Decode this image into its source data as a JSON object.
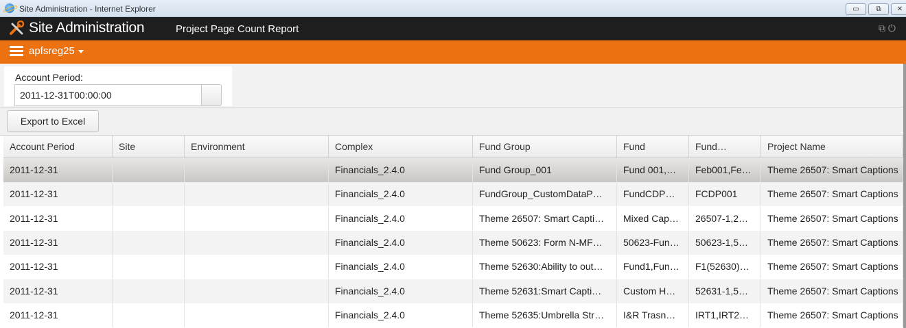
{
  "window": {
    "title": "Site Administration - Internet Explorer"
  },
  "app": {
    "title": "Site Administration",
    "report_title": "Project Page Count Report"
  },
  "tenant": {
    "name": "apfsreg25"
  },
  "filter": {
    "label": "Account Period:",
    "value": "2011-12-31T00:00:00"
  },
  "toolbar": {
    "export_label": "Export to Excel"
  },
  "grid": {
    "columns": [
      "Account Period",
      "Site",
      "Environment",
      "Complex",
      "Fund Group",
      "Fund",
      "Fund…",
      "Project Name"
    ],
    "rows": [
      [
        "2011-12-31",
        "",
        "",
        "Financials_2.4.0",
        "Fund Group_001",
        "Fund 001,…",
        "Feb001,Fe…",
        "Theme 26507: Smart Captions"
      ],
      [
        "2011-12-31",
        "",
        "",
        "Financials_2.4.0",
        "FundGroup_CustomDataP…",
        "FundCDP…",
        "FCDP001",
        "Theme 26507: Smart Captions"
      ],
      [
        "2011-12-31",
        "",
        "",
        "Financials_2.4.0",
        "Theme 26507: Smart Capti…",
        "Mixed Cap…",
        "26507-1,2…",
        "Theme 26507: Smart Captions"
      ],
      [
        "2011-12-31",
        "",
        "",
        "Financials_2.4.0",
        "Theme 50623: Form N-MF…",
        "50623-Fun…",
        "50623-1,5…",
        "Theme 26507: Smart Captions"
      ],
      [
        "2011-12-31",
        "",
        "",
        "Financials_2.4.0",
        "Theme 52630:Ability to out…",
        "Fund1,Fun…",
        "F1(52630)…",
        "Theme 26507: Smart Captions"
      ],
      [
        "2011-12-31",
        "",
        "",
        "Financials_2.4.0",
        "Theme 52631:Smart Capti…",
        "Custom H…",
        "52631-1,5…",
        "Theme 26507: Smart Captions"
      ],
      [
        "2011-12-31",
        "",
        "",
        "Financials_2.4.0",
        "Theme 52635:Umbrella Str…",
        "I&R Trasn…",
        "IRT1,IRT2…",
        "Theme 26507: Smart Captions"
      ]
    ]
  },
  "colors": {
    "accent": "#ec7211",
    "appbar": "#1e1e1e"
  }
}
